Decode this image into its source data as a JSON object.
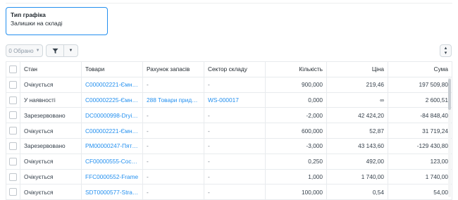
{
  "chart_type": {
    "label": "Тип графіка",
    "value": "Залишки на складі"
  },
  "toolbar": {
    "selected_label": "0 Обрано",
    "caret_icon": "caret-down-icon",
    "filter_icon": "filter-icon",
    "sort_icon": "sort-icon"
  },
  "table": {
    "headers": {
      "status": "Стан",
      "goods": "Товари",
      "account": "Рахунок запасів",
      "sector": "Сектор складу",
      "qty": "Кількість",
      "price": "Ціна",
      "sum": "Сума"
    },
    "rows": [
      {
        "status": "Очікується",
        "goods": "C000002221-Ємніст…",
        "account": "-",
        "sector": "-",
        "qty": "900,000",
        "price": "219,46",
        "sum": "197 509,80"
      },
      {
        "status": "У наявності",
        "goods": "C000002225-Ємніст…",
        "account": "288 Товари придба…",
        "sector": "WS-000017",
        "qty": "0,000",
        "price": "∞",
        "sum": "2 600,51"
      },
      {
        "status": "Зарезервовано",
        "goods": "DC00000998-Drying …",
        "account": "-",
        "sector": "-",
        "qty": "-2,000",
        "price": "42 424,20",
        "sum": "-84 848,40"
      },
      {
        "status": "Очікується",
        "goods": "C000002221-Ємніст…",
        "account": "-",
        "sector": "-",
        "qty": "600,000",
        "price": "52,87",
        "sum": "31 719,24"
      },
      {
        "status": "Зарезервовано",
        "goods": "PM00000247-Пятив…",
        "account": "-",
        "sector": "-",
        "qty": "-3,000",
        "price": "43 143,60",
        "sum": "-129 430,80"
      },
      {
        "status": "Очікується",
        "goods": "CF00000555-Coconu…",
        "account": "-",
        "sector": "-",
        "qty": "0,250",
        "price": "492,00",
        "sum": "123,00"
      },
      {
        "status": "Очікується",
        "goods": "FFC0000552-Frame",
        "account": "-",
        "sector": "-",
        "qty": "1,000",
        "price": "1 740,00",
        "sum": "1 740,00"
      },
      {
        "status": "Очікується",
        "goods": "SDT0000577-Strawb…",
        "account": "-",
        "sector": "-",
        "qty": "100,000",
        "price": "0,54",
        "sum": "54,00"
      }
    ]
  }
}
